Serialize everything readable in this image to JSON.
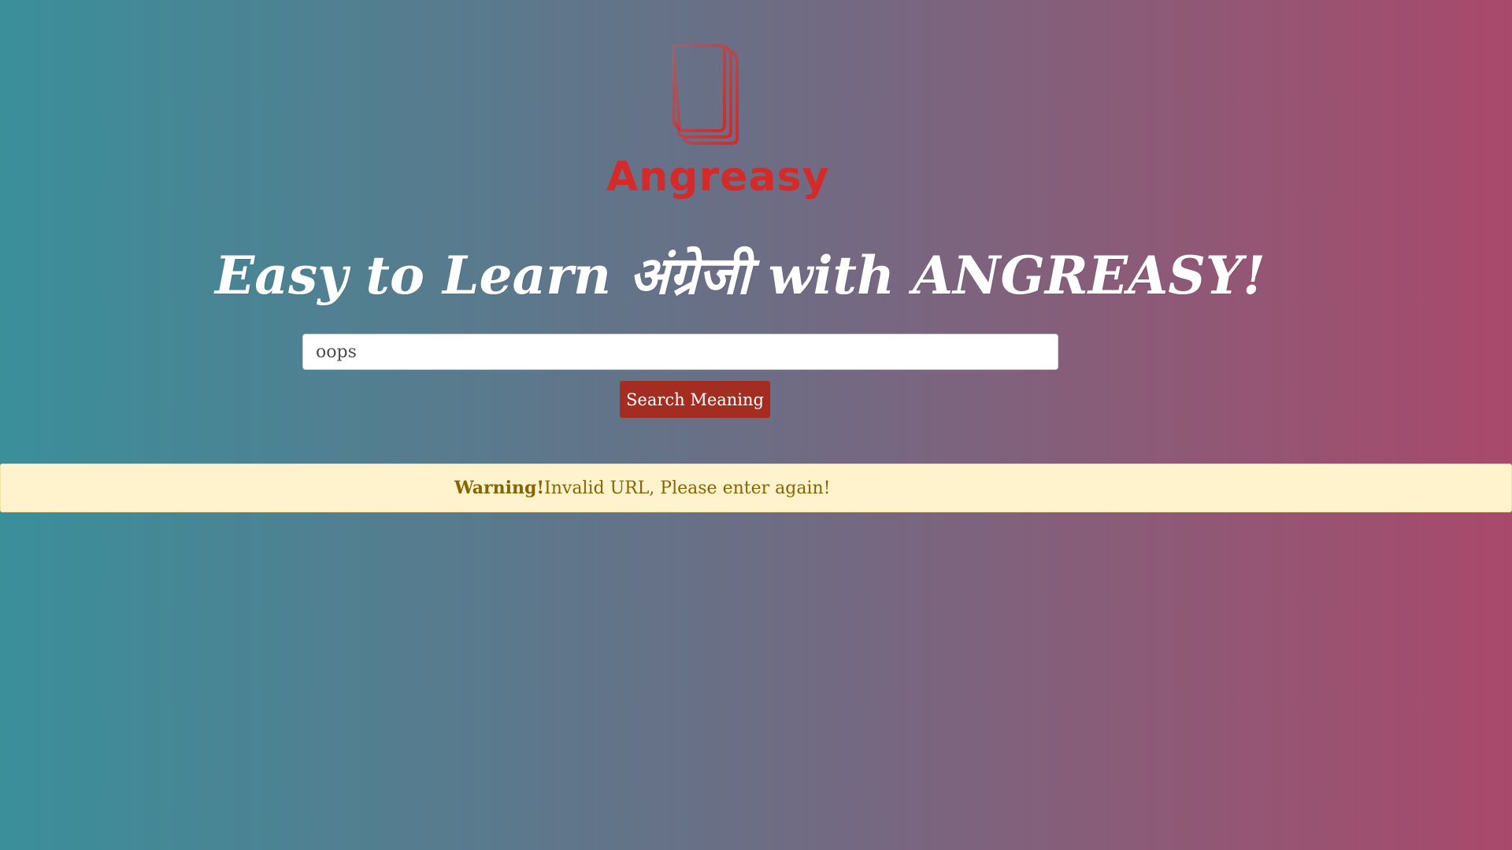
{
  "brand": {
    "name": "Angreasy",
    "logo_icon": "stacked-pages-icon",
    "color": "#d42a2a"
  },
  "headline": {
    "text": "Easy to Learn अंग्रेजी with ANGREASY!"
  },
  "search": {
    "value": "oops",
    "button_label": "Search Meaning",
    "button_color": "#a42d22"
  },
  "alert": {
    "title": "Warning!",
    "message": "Invalid URL, Please enter again!",
    "background": "#fff3cd",
    "text_color": "#856404"
  }
}
